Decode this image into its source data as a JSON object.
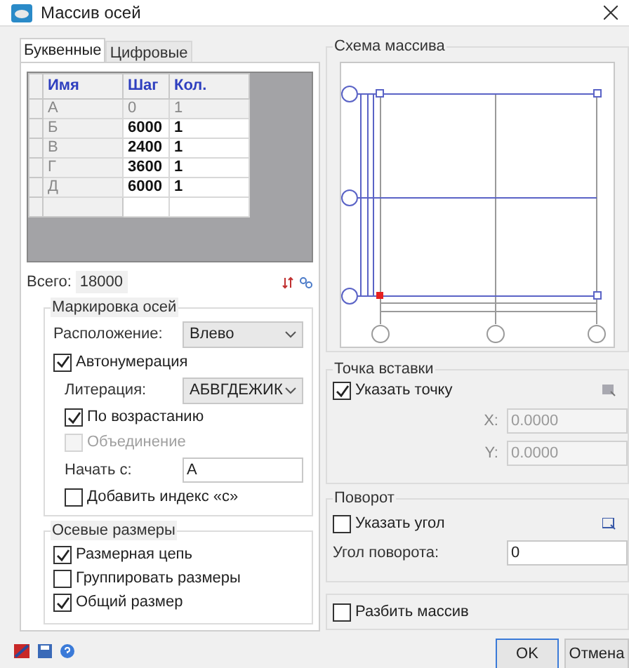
{
  "window": {
    "title": "Массив осей"
  },
  "tabs": [
    {
      "label": "Буквенные",
      "selected": true
    },
    {
      "label": "Цифровые",
      "selected": false
    }
  ],
  "table": {
    "columns": [
      "Имя",
      "Шаг",
      "Кол."
    ],
    "rows": [
      {
        "cells": [
          "А",
          "0",
          "1"
        ],
        "locked": true
      },
      {
        "cells": [
          "Б",
          "6000",
          "1"
        ],
        "locked": false
      },
      {
        "cells": [
          "В",
          "2400",
          "1"
        ],
        "locked": false
      },
      {
        "cells": [
          "Г",
          "3600",
          "1"
        ],
        "locked": false
      },
      {
        "cells": [
          "Д",
          "6000",
          "1"
        ],
        "locked": false
      }
    ]
  },
  "total": {
    "label": "Всего:",
    "value": "18000"
  },
  "marking": {
    "title": "Маркировка осей",
    "position_label": "Расположение:",
    "position_value": "Влево",
    "autonumber": {
      "label": "Автонумерация",
      "checked": true
    },
    "letters_label": "Литерация:",
    "letters_value": "АБВГДЕЖИК",
    "ascending": {
      "label": "По возрастанию",
      "checked": true,
      "disabled": false
    },
    "merge": {
      "label": "Объединение",
      "checked": false,
      "disabled": true
    },
    "start_label": "Начать с:",
    "start_value": "А",
    "index": {
      "label": "Добавить индекс «с»",
      "checked": false,
      "disabled": false
    }
  },
  "dimensions": {
    "title": "Осевые размеры",
    "options": [
      {
        "label": "Размерная цепь",
        "checked": true
      },
      {
        "label": "Группировать размеры",
        "checked": false
      },
      {
        "label": "Общий размер",
        "checked": true
      }
    ]
  },
  "schema": {
    "title": "Схема массива"
  },
  "insert": {
    "title": "Точка вставки",
    "pick": {
      "label": "Указать точку",
      "checked": true
    },
    "x_label": "X:",
    "x_value": "0.0000",
    "y_label": "Y:",
    "y_value": "0.0000",
    "fields_disabled": true
  },
  "rotation": {
    "title": "Поворот",
    "pick": {
      "label": "Указать угол",
      "checked": false
    },
    "angle_label": "Угол поворота:",
    "angle_value": "0"
  },
  "explode": {
    "label": "Разбить массив",
    "checked": false
  },
  "buttons": [
    "OK",
    "Отмена"
  ]
}
